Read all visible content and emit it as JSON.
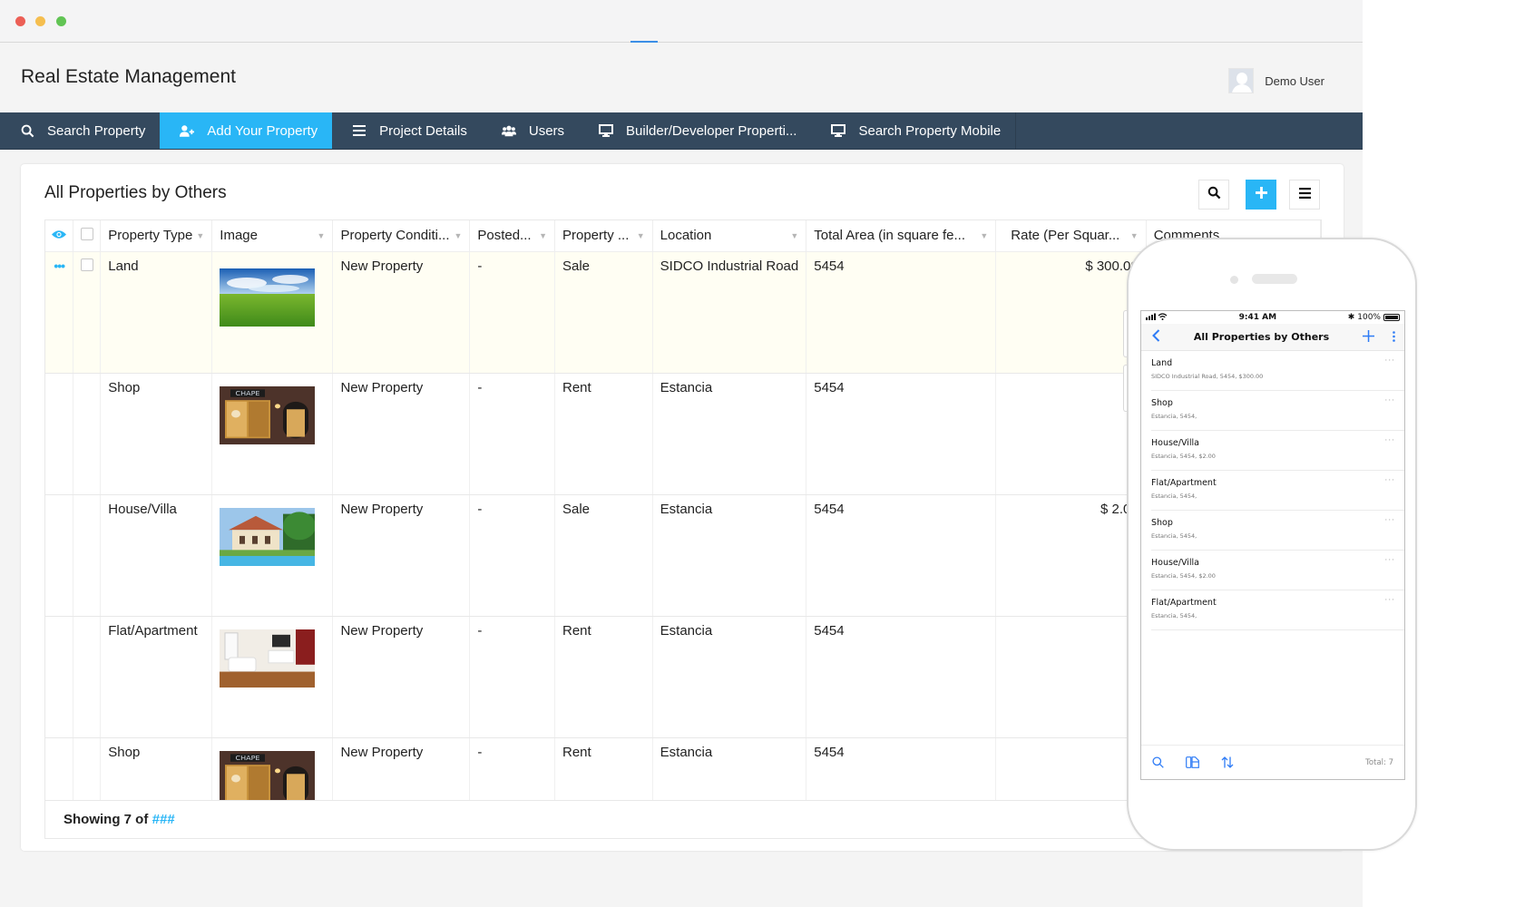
{
  "app": {
    "title": "Real Estate Management",
    "user": "Demo User"
  },
  "nav": {
    "items": [
      {
        "label": "Search Property",
        "icon": "search-icon",
        "active": false
      },
      {
        "label": "Add Your Property",
        "icon": "user-plus-icon",
        "active": true
      },
      {
        "label": "Project Details",
        "icon": "list-icon",
        "active": false
      },
      {
        "label": "Users",
        "icon": "users-icon",
        "active": false
      },
      {
        "label": "Builder/Developer Properti...",
        "icon": "monitor-icon",
        "active": false
      },
      {
        "label": "Search Property Mobile",
        "icon": "monitor-icon",
        "active": false
      }
    ]
  },
  "card": {
    "title": "All Properties by Others",
    "toolbar": {
      "search": "search-icon",
      "add": "plus-icon",
      "menu": "hamburger-icon"
    }
  },
  "table": {
    "columns": [
      "Property Type",
      "Image",
      "Property Conditi...",
      "Posted...",
      "Property ...",
      "Location",
      "Total Area (in square fe...",
      "Rate (Per Squar...",
      "Comments"
    ],
    "rows": [
      {
        "type": "Land",
        "image": "green-field",
        "condition": "New Property",
        "posted": "-",
        "purpose": "Sale",
        "location": "SIDCO Industrial Road",
        "area": "5454",
        "rate": "$ 300.00",
        "comments": ""
      },
      {
        "type": "Shop",
        "image": "shop-front",
        "condition": "New Property",
        "posted": "-",
        "purpose": "Rent",
        "location": "Estancia",
        "area": "5454",
        "rate": "",
        "comments": ""
      },
      {
        "type": "House/Villa",
        "image": "villa",
        "condition": "New Property",
        "posted": "-",
        "purpose": "Sale",
        "location": "Estancia",
        "area": "5454",
        "rate": "$ 2.00",
        "comments": ""
      },
      {
        "type": "Flat/Apartment",
        "image": "apartment-interior",
        "condition": "New Property",
        "posted": "-",
        "purpose": "Rent",
        "location": "Estancia",
        "area": "5454",
        "rate": "",
        "comments": ""
      },
      {
        "type": "Shop",
        "image": "shop-front",
        "condition": "New Property",
        "posted": "-",
        "purpose": "Rent",
        "location": "Estancia",
        "area": "5454",
        "rate": "",
        "comments": ""
      }
    ],
    "footer": {
      "prefix": "Showing 7 of ",
      "link": "###"
    }
  },
  "colors": {
    "nav_bg": "#34495e",
    "accent": "#29b6f6",
    "highlight_row": "#fffef3",
    "mobile_blue": "#2f7cf6"
  },
  "mobile": {
    "status": {
      "time": "9:41 AM",
      "battery": "100%"
    },
    "title": "All Properties by Others",
    "items": [
      {
        "title": "Land",
        "subtitle": "SIDCO Industrial Road, 5454, $300.00"
      },
      {
        "title": "Shop",
        "subtitle": "Estancia, 5454,"
      },
      {
        "title": "House/Villa",
        "subtitle": "Estancia, 5454, $2.00"
      },
      {
        "title": "Flat/Apartment",
        "subtitle": "Estancia, 5454,"
      },
      {
        "title": "Shop",
        "subtitle": "Estancia, 5454,"
      },
      {
        "title": "House/Villa",
        "subtitle": "Estancia, 5454, $2.00"
      },
      {
        "title": "Flat/Apartment",
        "subtitle": "Estancia, 5454,"
      }
    ],
    "more": "···",
    "total": "Total: 7"
  }
}
